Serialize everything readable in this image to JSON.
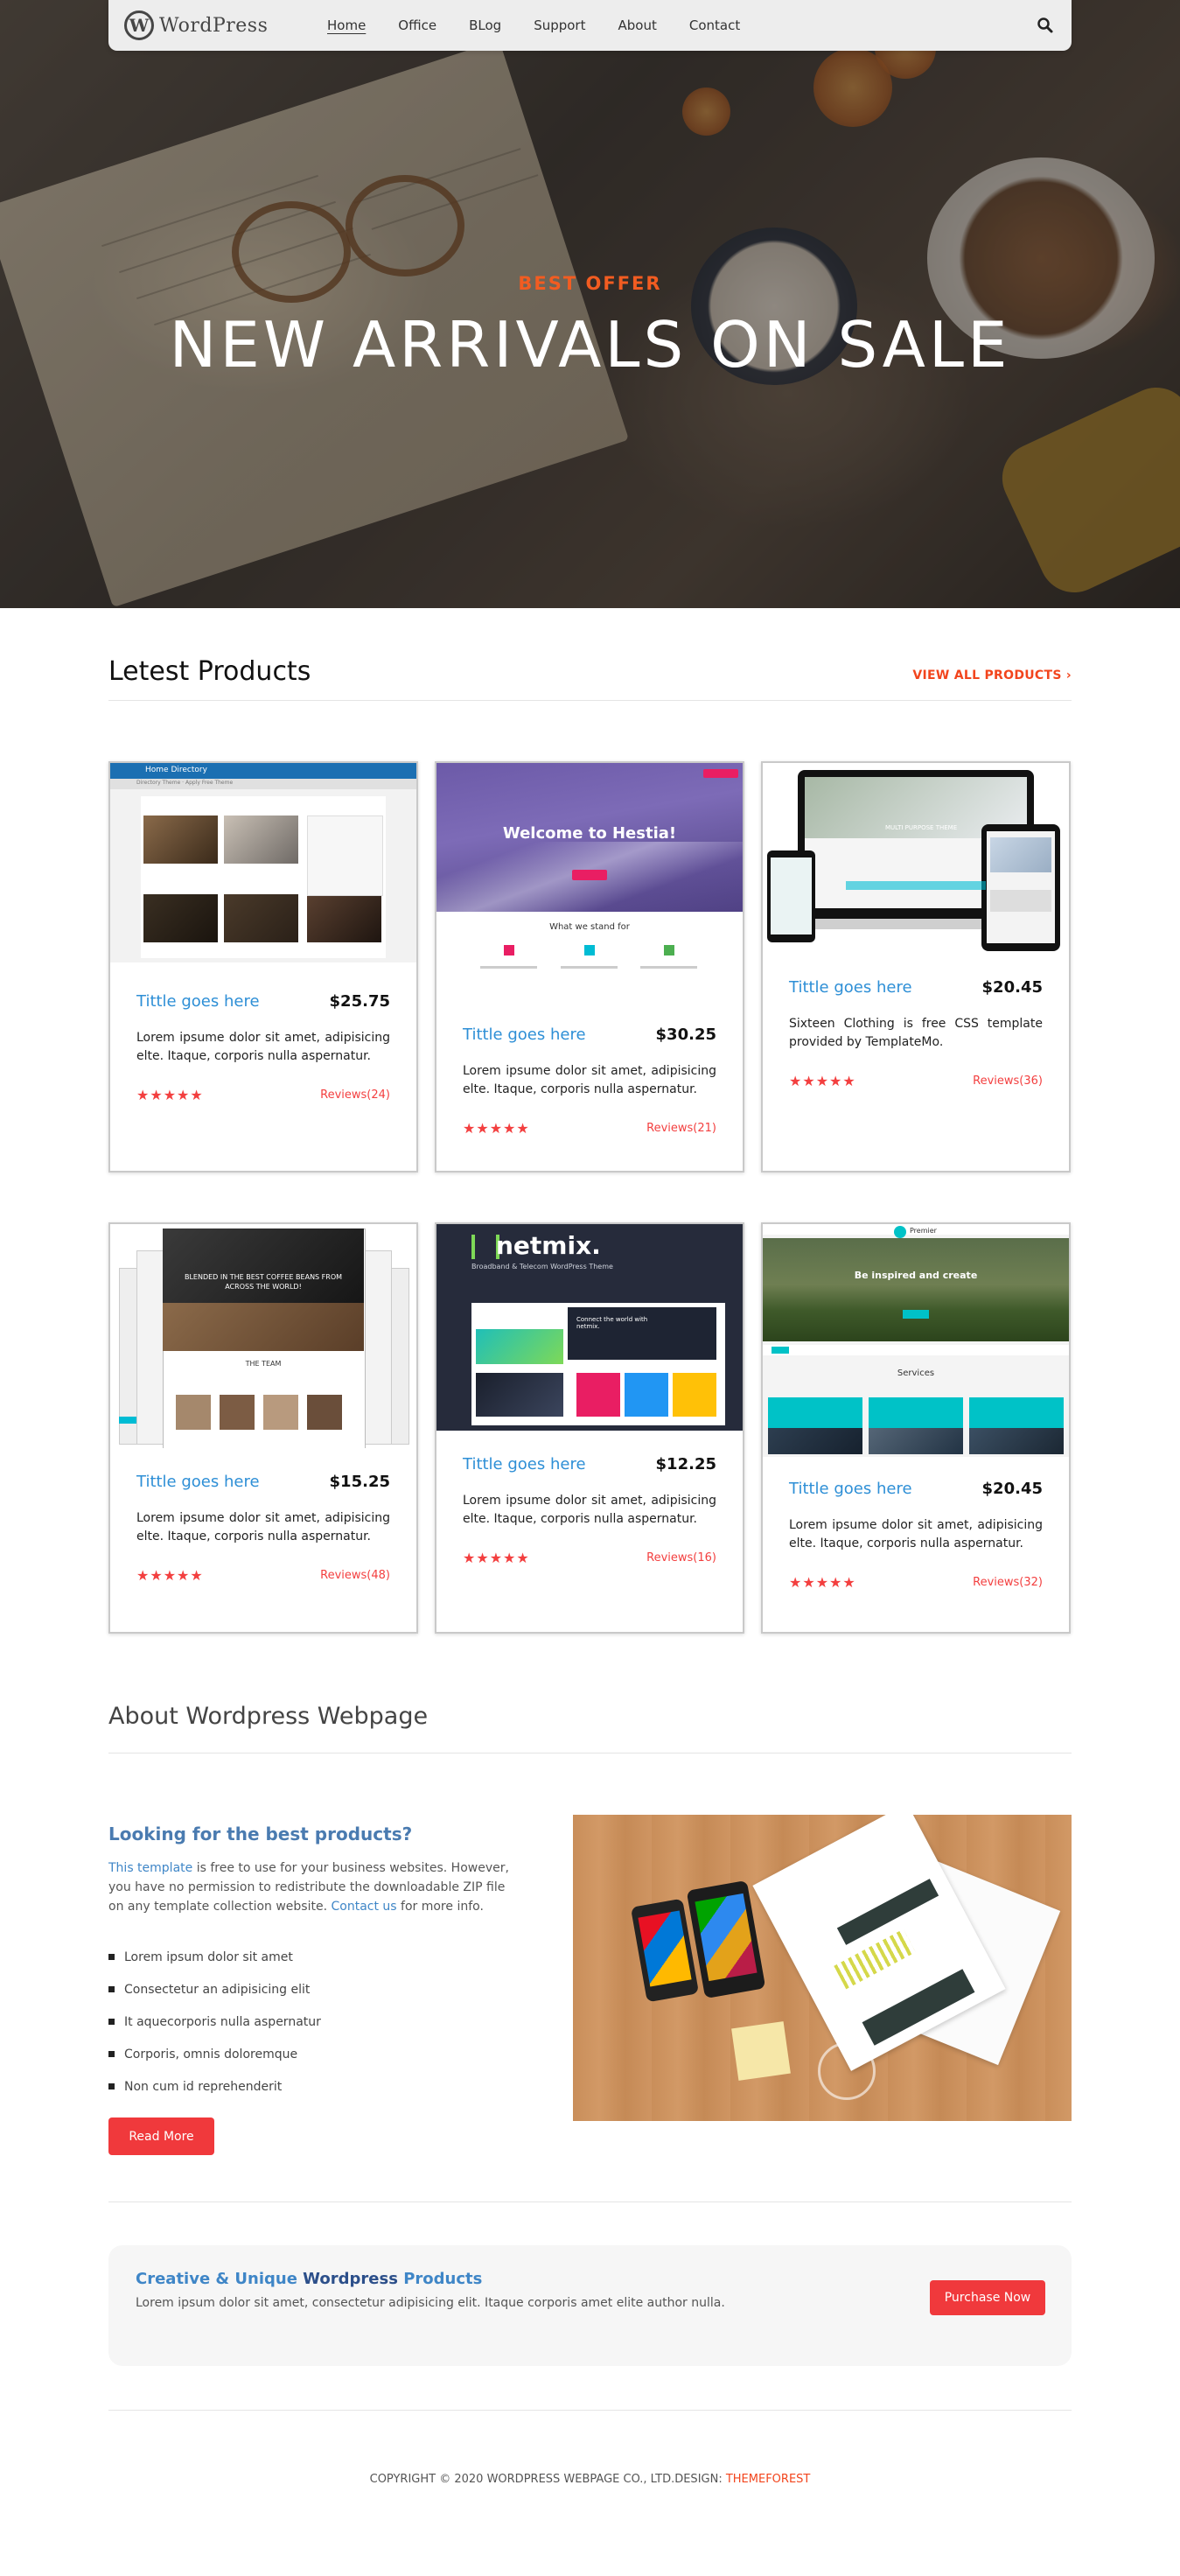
{
  "nav": {
    "logo_text": "WordPress",
    "logo_mark": "W",
    "links": [
      "Home",
      "Office",
      "BLog",
      "Support",
      "About",
      "Contact"
    ],
    "active": "Home",
    "search_icon": "search-icon"
  },
  "hero": {
    "kicker": "BEST OFFER",
    "title": "NEW ARRIVALS ON SALE"
  },
  "products_section": {
    "title": "Letest Products",
    "view_all": "VIEW ALL PRODUCTS",
    "view_all_icon": "chevron-right-icon"
  },
  "products": [
    {
      "title": "Tittle goes here",
      "price": "$25.75",
      "desc": "Lorem ipsume dolor sit amet, adipisicing elte. Itaque, corporis nulla aspernatur.",
      "stars": "★★★★★",
      "reviews": "Reviews(24)",
      "thumb": {
        "header": "Home Directory",
        "sub": "Directory Theme · Apply Free Theme"
      }
    },
    {
      "title": "Tittle goes here",
      "price": "$30.25",
      "desc": "Lorem ipsume dolor sit amet, adipisicing elte. Itaque, corporis nulla aspernatur.",
      "stars": "★★★★★",
      "reviews": "Reviews(21)",
      "thumb": {
        "header": "Welcome to Hestia!",
        "sub": "What we stand for"
      }
    },
    {
      "title": "Tittle goes here",
      "price": "$20.45",
      "desc": "Sixteen Clothing is free CSS template provided by TemplateMo.",
      "stars": "★★★★★",
      "reviews": "Reviews(36)",
      "thumb": {
        "header": "MULTI PURPOSE THEME"
      }
    },
    {
      "title": "Tittle goes here",
      "price": "$15.25",
      "desc": "Lorem ipsume dolor sit amet, adipisicing elte. Itaque, corporis nulla aspernatur.",
      "stars": "★★★★★",
      "reviews": "Reviews(48)",
      "thumb": {
        "header": "BLENDED IN THE BEST COFFEE BEANS FROM ACROSS THE WORLD!",
        "sub": "THE TEAM"
      }
    },
    {
      "title": "Tittle goes here",
      "price": "$12.25",
      "desc": "Lorem ipsume dolor sit amet, adipisicing elte. Itaque, corporis nulla aspernatur.",
      "stars": "★★★★★",
      "reviews": "Reviews(16)",
      "thumb": {
        "header": "netmix.",
        "sub": "Broadband & Telecom WordPress Theme",
        "panel": "Connect the world with netmix."
      }
    },
    {
      "title": "Tittle goes here",
      "price": "$20.45",
      "desc": "Lorem ipsume dolor sit amet, adipisicing elte. Itaque, corporis nulla aspernatur.",
      "stars": "★★★★★",
      "reviews": "Reviews(32)",
      "thumb": {
        "header": "Be inspired and create",
        "sub": "Services",
        "brand": "Premier"
      }
    }
  ],
  "about": {
    "section_title": "About Wordpress Webpage",
    "heading": "Looking for the best products?",
    "para_link1": "This template",
    "para_text1": " is free to use for your business websites. However, you have no permission to redistribute the downloadable ZIP file on any template collection website. ",
    "para_link2": "Contact us",
    "para_text2": " for more info.",
    "bullets": [
      "Lorem ipsum dolor sit amet",
      "Consectetur an adipisicing elit",
      "It aquecorporis nulla aspernatur",
      "Corporis, omnis doloremque",
      "Non cum id reprehenderit"
    ],
    "button": "Read More"
  },
  "cta": {
    "title_a": "Creative & Unique ",
    "title_b": "Wordpress",
    "title_c": " Products",
    "text": "Lorem ipsum dolor sit amet, consectetur adipisicing elit. Itaque corporis amet elite author nulla.",
    "button": "Purchase Now"
  },
  "footer": {
    "text": "COPYRIGHT © 2020 WORDPRESS WEBPAGE CO., LTD.DESIGN: ",
    "link": "THEMEFOREST"
  },
  "colors": {
    "accent": "#f2451d",
    "link_blue": "#2e8fd6",
    "button_red": "#f0393c",
    "star_red": "#f33f3f"
  }
}
